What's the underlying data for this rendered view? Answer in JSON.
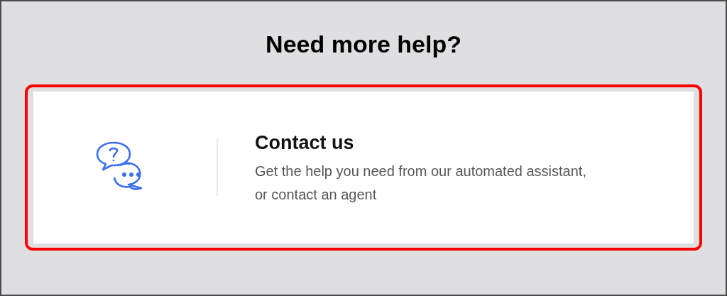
{
  "heading": "Need more help?",
  "card": {
    "title": "Contact us",
    "description": "Get the help you need from our automated assistant, or contact an agent",
    "highlighted": true
  }
}
